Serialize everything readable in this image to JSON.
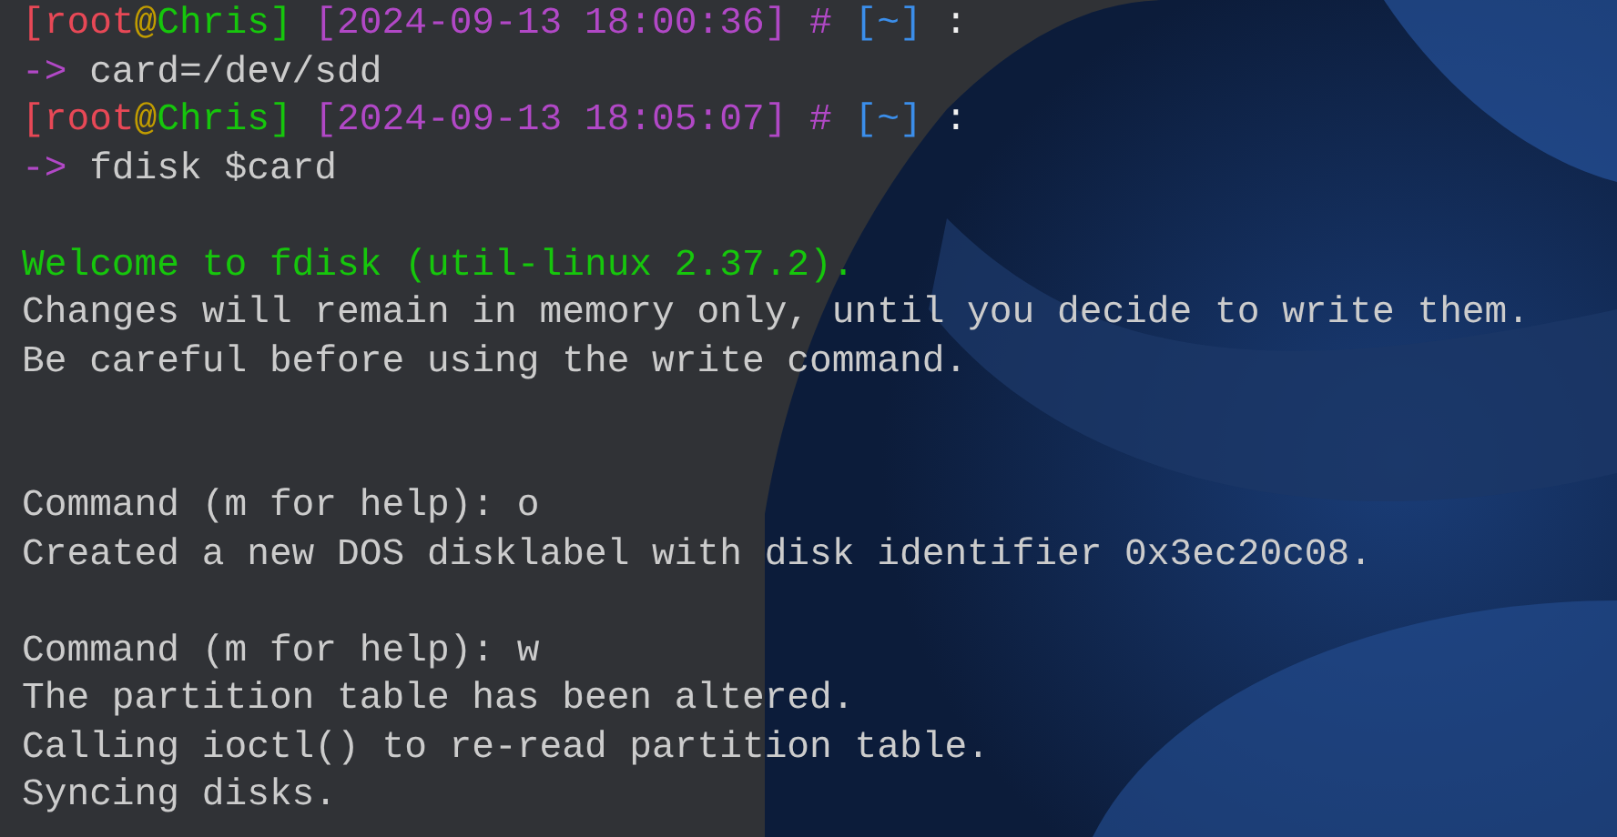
{
  "terminal": {
    "lines": [
      {
        "kind": "text",
        "segments": [
          {
            "text": "[root",
            "color": "#e74856"
          },
          {
            "text": "@",
            "color": "#c19c00"
          },
          {
            "text": "Chris]",
            "color": "#16c60c"
          },
          {
            "text": " [2024-09-13 18:00:36] #",
            "color": "#b148c6"
          },
          {
            "text": " [~]",
            "color": "#3b8eea"
          },
          {
            "text": " :",
            "color": "#f2f2f2"
          }
        ]
      },
      {
        "kind": "text",
        "segments": [
          {
            "text": "->",
            "color": "#b148c6"
          },
          {
            "text": " card=/dev/sdd",
            "color": "#cccccc"
          }
        ]
      },
      {
        "kind": "text",
        "segments": [
          {
            "text": "[root",
            "color": "#e74856"
          },
          {
            "text": "@",
            "color": "#c19c00"
          },
          {
            "text": "Chris]",
            "color": "#16c60c"
          },
          {
            "text": " [2024-09-13 18:05:07] #",
            "color": "#b148c6"
          },
          {
            "text": " [~]",
            "color": "#3b8eea"
          },
          {
            "text": " :",
            "color": "#f2f2f2"
          }
        ]
      },
      {
        "kind": "text",
        "segments": [
          {
            "text": "->",
            "color": "#b148c6"
          },
          {
            "text": " fdisk $card",
            "color": "#cccccc"
          }
        ]
      },
      {
        "kind": "blank"
      },
      {
        "kind": "text",
        "segments": [
          {
            "text": "Welcome to fdisk (util-linux 2.37.2).",
            "color": "#16c60c"
          }
        ]
      },
      {
        "kind": "text",
        "segments": [
          {
            "text": "Changes will remain in memory only, until you decide to write them.",
            "color": "#cccccc"
          }
        ]
      },
      {
        "kind": "text",
        "segments": [
          {
            "text": "Be careful before using the write command.",
            "color": "#cccccc"
          }
        ]
      },
      {
        "kind": "blank"
      },
      {
        "kind": "blank"
      },
      {
        "kind": "text",
        "segments": [
          {
            "text": "Command (m for help): o",
            "color": "#cccccc"
          }
        ]
      },
      {
        "kind": "text",
        "segments": [
          {
            "text": "Created a new DOS disklabel with disk identifier 0x3ec20c08.",
            "color": "#cccccc"
          }
        ]
      },
      {
        "kind": "blank"
      },
      {
        "kind": "text",
        "segments": [
          {
            "text": "Command (m for help): w",
            "color": "#cccccc"
          }
        ]
      },
      {
        "kind": "text",
        "segments": [
          {
            "text": "The partition table has been altered.",
            "color": "#cccccc"
          }
        ]
      },
      {
        "kind": "text",
        "segments": [
          {
            "text": "Calling ioctl() to re-read partition table.",
            "color": "#cccccc"
          }
        ]
      },
      {
        "kind": "text",
        "segments": [
          {
            "text": "Syncing disks.",
            "color": "#cccccc"
          }
        ]
      }
    ]
  }
}
